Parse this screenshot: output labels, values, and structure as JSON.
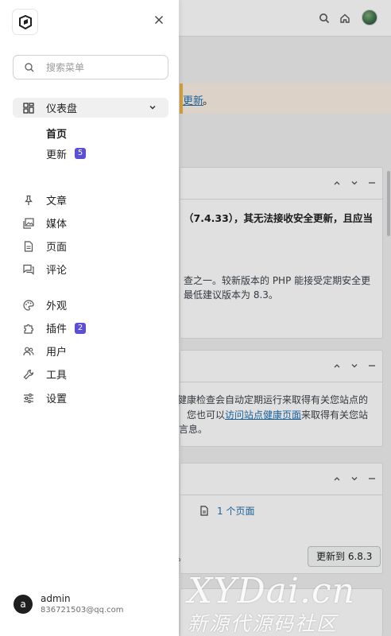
{
  "drawer": {
    "search_placeholder": "搜索菜单",
    "dashboard_label": "仪表盘",
    "dashboard_children": [
      {
        "label": "首页"
      },
      {
        "label": "更新",
        "badge": "5"
      }
    ],
    "nav_group_content": [
      {
        "label": "文章",
        "icon": "pin-icon"
      },
      {
        "label": "媒体",
        "icon": "media-icon"
      },
      {
        "label": "页面",
        "icon": "page-icon"
      },
      {
        "label": "评论",
        "icon": "comment-icon"
      }
    ],
    "nav_group_site": [
      {
        "label": "外观",
        "icon": "palette-icon"
      },
      {
        "label": "插件",
        "icon": "plugin-icon",
        "badge": "2"
      },
      {
        "label": "用户",
        "icon": "users-icon"
      },
      {
        "label": "工具",
        "icon": "wrench-icon"
      },
      {
        "label": "设置",
        "icon": "sliders-icon"
      }
    ],
    "user": {
      "initial": "a",
      "name": "admin",
      "email": "836721503@qq.com"
    }
  },
  "background": {
    "notice_link": "更新",
    "notice_suffix": "。",
    "card1": {
      "line1": "（7.4.33），其无法接收安全更新，且应当",
      "line2": "查之一。较新版本的 PHP 能接受定期安全更",
      "line3": "最低建议版本为 8.3。"
    },
    "card2": {
      "line1": "健康检查会自动定期运行来取得有关您站点的",
      "line2_prefix": "您也可以",
      "line2_link": "访问站点健康页面",
      "line2_suffix": "来取得有关您站",
      "line3": "言息。"
    },
    "card3": {
      "pages_link": "1 个页面",
      "trailing": "。",
      "update_button": "更新到 6.8.3"
    }
  },
  "watermark": {
    "line1": "XYDai.cn",
    "line2": "新源代源码社区"
  },
  "colors": {
    "accent": "#5b4fd8",
    "link": "#2271b1",
    "notice_bg": "#fcf0e3",
    "notice_border": "#f0b849"
  }
}
